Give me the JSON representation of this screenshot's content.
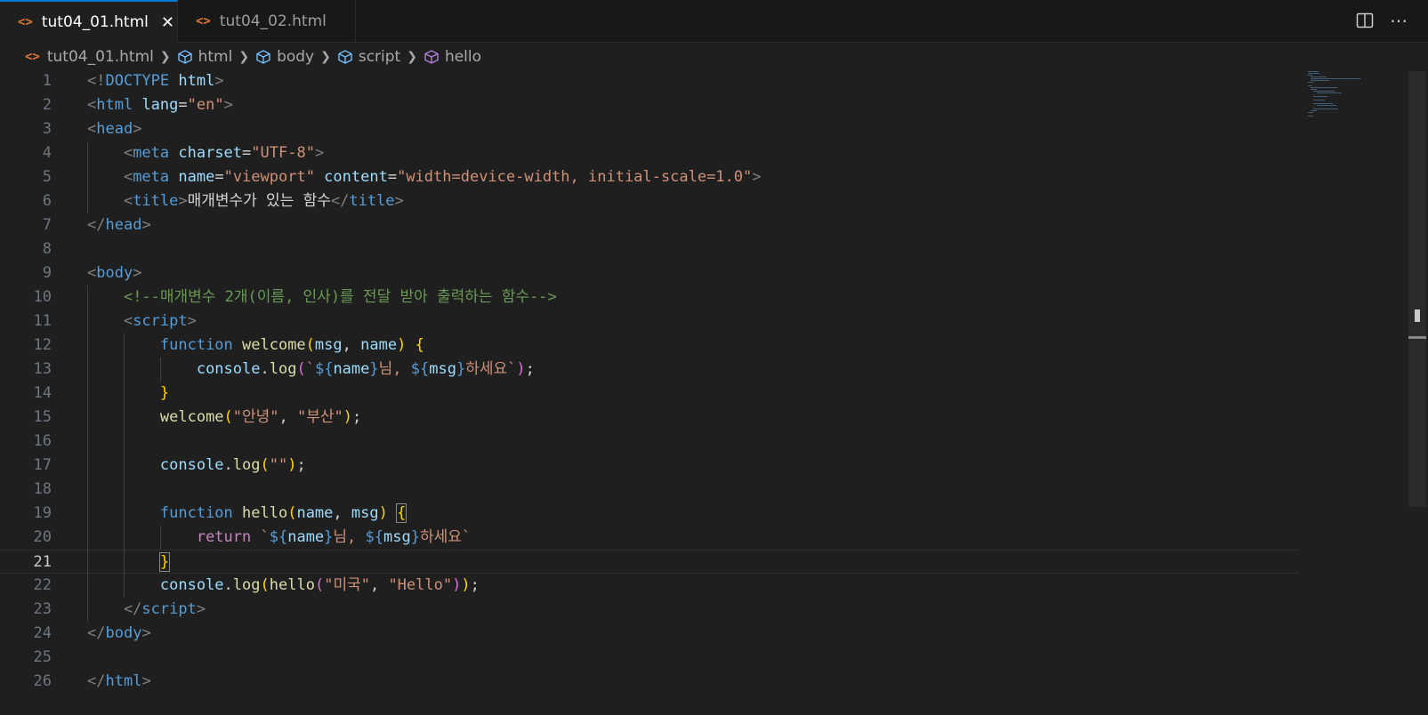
{
  "tabs": [
    {
      "label": "tut04_01.html",
      "active": true
    },
    {
      "label": "tut04_02.html",
      "active": false
    }
  ],
  "tab_icon": "<>",
  "tab_actions": {
    "split": "split-editor-icon",
    "more": "⋯"
  },
  "breadcrumb": {
    "file": "tut04_01.html",
    "items": [
      "html",
      "body",
      "script",
      "hello"
    ]
  },
  "editor": {
    "current_line": 21,
    "lines": [
      [
        [
          "<!",
          "t-punct"
        ],
        [
          "DOCTYPE ",
          "t-tag"
        ],
        [
          "html",
          "t-attr"
        ],
        [
          ">",
          "t-punct"
        ]
      ],
      [
        [
          "<",
          "t-punct"
        ],
        [
          "html ",
          "t-tag"
        ],
        [
          "lang",
          "t-attr"
        ],
        [
          "=",
          "t-default"
        ],
        [
          "\"en\"",
          "t-str"
        ],
        [
          ">",
          "t-punct"
        ]
      ],
      [
        [
          "<",
          "t-punct"
        ],
        [
          "head",
          "t-tag"
        ],
        [
          ">",
          "t-punct"
        ]
      ],
      [
        [
          "    <",
          "t-punct"
        ],
        [
          "meta ",
          "t-tag"
        ],
        [
          "charset",
          "t-attr"
        ],
        [
          "=",
          "t-default"
        ],
        [
          "\"UTF-8\"",
          "t-str"
        ],
        [
          ">",
          "t-punct"
        ]
      ],
      [
        [
          "    <",
          "t-punct"
        ],
        [
          "meta ",
          "t-tag"
        ],
        [
          "name",
          "t-attr"
        ],
        [
          "=",
          "t-default"
        ],
        [
          "\"viewport\" ",
          "t-str"
        ],
        [
          "content",
          "t-attr"
        ],
        [
          "=",
          "t-default"
        ],
        [
          "\"width=device-width, initial-scale=1.0\"",
          "t-str"
        ],
        [
          ">",
          "t-punct"
        ]
      ],
      [
        [
          "    <",
          "t-punct"
        ],
        [
          "title",
          "t-tag"
        ],
        [
          ">",
          "t-punct"
        ],
        [
          "매개변수가 있는 함수",
          "t-text"
        ],
        [
          "</",
          "t-punct"
        ],
        [
          "title",
          "t-tag"
        ],
        [
          ">",
          "t-punct"
        ]
      ],
      [
        [
          "</",
          "t-punct"
        ],
        [
          "head",
          "t-tag"
        ],
        [
          ">",
          "t-punct"
        ]
      ],
      [],
      [
        [
          "<",
          "t-punct"
        ],
        [
          "body",
          "t-tag"
        ],
        [
          ">",
          "t-punct"
        ]
      ],
      [
        [
          "    ",
          "t-default"
        ],
        [
          "<!--매개변수 2개(이름, 인사)를 전달 받아 출력하는 함수-->",
          "t-comment"
        ]
      ],
      [
        [
          "    <",
          "t-punct"
        ],
        [
          "script",
          "t-tag"
        ],
        [
          ">",
          "t-punct"
        ]
      ],
      [
        [
          "        ",
          "t-default"
        ],
        [
          "function ",
          "t-kw"
        ],
        [
          "welcome",
          "t-fn"
        ],
        [
          "(",
          "t-b1"
        ],
        [
          "msg",
          "t-var"
        ],
        [
          ", ",
          "t-default"
        ],
        [
          "name",
          "t-var"
        ],
        [
          ")",
          "t-b1"
        ],
        [
          " ",
          "t-default"
        ],
        [
          "{",
          "t-b1"
        ]
      ],
      [
        [
          "            ",
          "t-default"
        ],
        [
          "console",
          "t-var"
        ],
        [
          ".",
          "t-default"
        ],
        [
          "log",
          "t-fn"
        ],
        [
          "(",
          "t-b2"
        ],
        [
          "`",
          "t-str"
        ],
        [
          "${",
          "t-kw"
        ],
        [
          "name",
          "t-var"
        ],
        [
          "}",
          "t-kw"
        ],
        [
          "님, ",
          "t-str"
        ],
        [
          "${",
          "t-kw"
        ],
        [
          "msg",
          "t-var"
        ],
        [
          "}",
          "t-kw"
        ],
        [
          "하세요`",
          "t-str"
        ],
        [
          ")",
          "t-b2"
        ],
        [
          ";",
          "t-default"
        ]
      ],
      [
        [
          "        ",
          "t-default"
        ],
        [
          "}",
          "t-b1"
        ]
      ],
      [
        [
          "        ",
          "t-default"
        ],
        [
          "welcome",
          "t-fn"
        ],
        [
          "(",
          "t-b1"
        ],
        [
          "\"안녕\"",
          "t-str"
        ],
        [
          ", ",
          "t-default"
        ],
        [
          "\"부산\"",
          "t-str"
        ],
        [
          ")",
          "t-b1"
        ],
        [
          ";",
          "t-default"
        ]
      ],
      [],
      [
        [
          "        ",
          "t-default"
        ],
        [
          "console",
          "t-var"
        ],
        [
          ".",
          "t-default"
        ],
        [
          "log",
          "t-fn"
        ],
        [
          "(",
          "t-b1"
        ],
        [
          "\"\"",
          "t-str"
        ],
        [
          ")",
          "t-b1"
        ],
        [
          ";",
          "t-default"
        ]
      ],
      [],
      [
        [
          "        ",
          "t-default"
        ],
        [
          "function ",
          "t-kw"
        ],
        [
          "hello",
          "t-fn"
        ],
        [
          "(",
          "t-b1"
        ],
        [
          "name",
          "t-var"
        ],
        [
          ", ",
          "t-default"
        ],
        [
          "msg",
          "t-var"
        ],
        [
          ")",
          "t-b1"
        ],
        [
          " ",
          "t-default"
        ],
        [
          "{",
          "t-b1 bracket-box"
        ]
      ],
      [
        [
          "            ",
          "t-default"
        ],
        [
          "return ",
          "t-ctrl"
        ],
        [
          "`",
          "t-str"
        ],
        [
          "${",
          "t-kw"
        ],
        [
          "name",
          "t-var"
        ],
        [
          "}",
          "t-kw"
        ],
        [
          "님, ",
          "t-str"
        ],
        [
          "${",
          "t-kw"
        ],
        [
          "msg",
          "t-var"
        ],
        [
          "}",
          "t-kw"
        ],
        [
          "하세요`",
          "t-str"
        ]
      ],
      [
        [
          "        ",
          "t-default"
        ],
        [
          "}",
          "t-b1 bracket-box"
        ]
      ],
      [
        [
          "        ",
          "t-default"
        ],
        [
          "console",
          "t-var"
        ],
        [
          ".",
          "t-default"
        ],
        [
          "log",
          "t-fn"
        ],
        [
          "(",
          "t-b1"
        ],
        [
          "hello",
          "t-fn"
        ],
        [
          "(",
          "t-b2"
        ],
        [
          "\"미국\"",
          "t-str"
        ],
        [
          ", ",
          "t-default"
        ],
        [
          "\"Hello\"",
          "t-str"
        ],
        [
          ")",
          "t-b2"
        ],
        [
          ")",
          "t-b1"
        ],
        [
          ";",
          "t-default"
        ]
      ],
      [
        [
          "    </",
          "t-punct"
        ],
        [
          "script",
          "t-tag"
        ],
        [
          ">",
          "t-punct"
        ]
      ],
      [
        [
          "</",
          "t-punct"
        ],
        [
          "body",
          "t-tag"
        ],
        [
          ">",
          "t-punct"
        ]
      ],
      [],
      [
        [
          "</",
          "t-punct"
        ],
        [
          "html",
          "t-tag"
        ],
        [
          ">",
          "t-punct"
        ]
      ]
    ]
  }
}
